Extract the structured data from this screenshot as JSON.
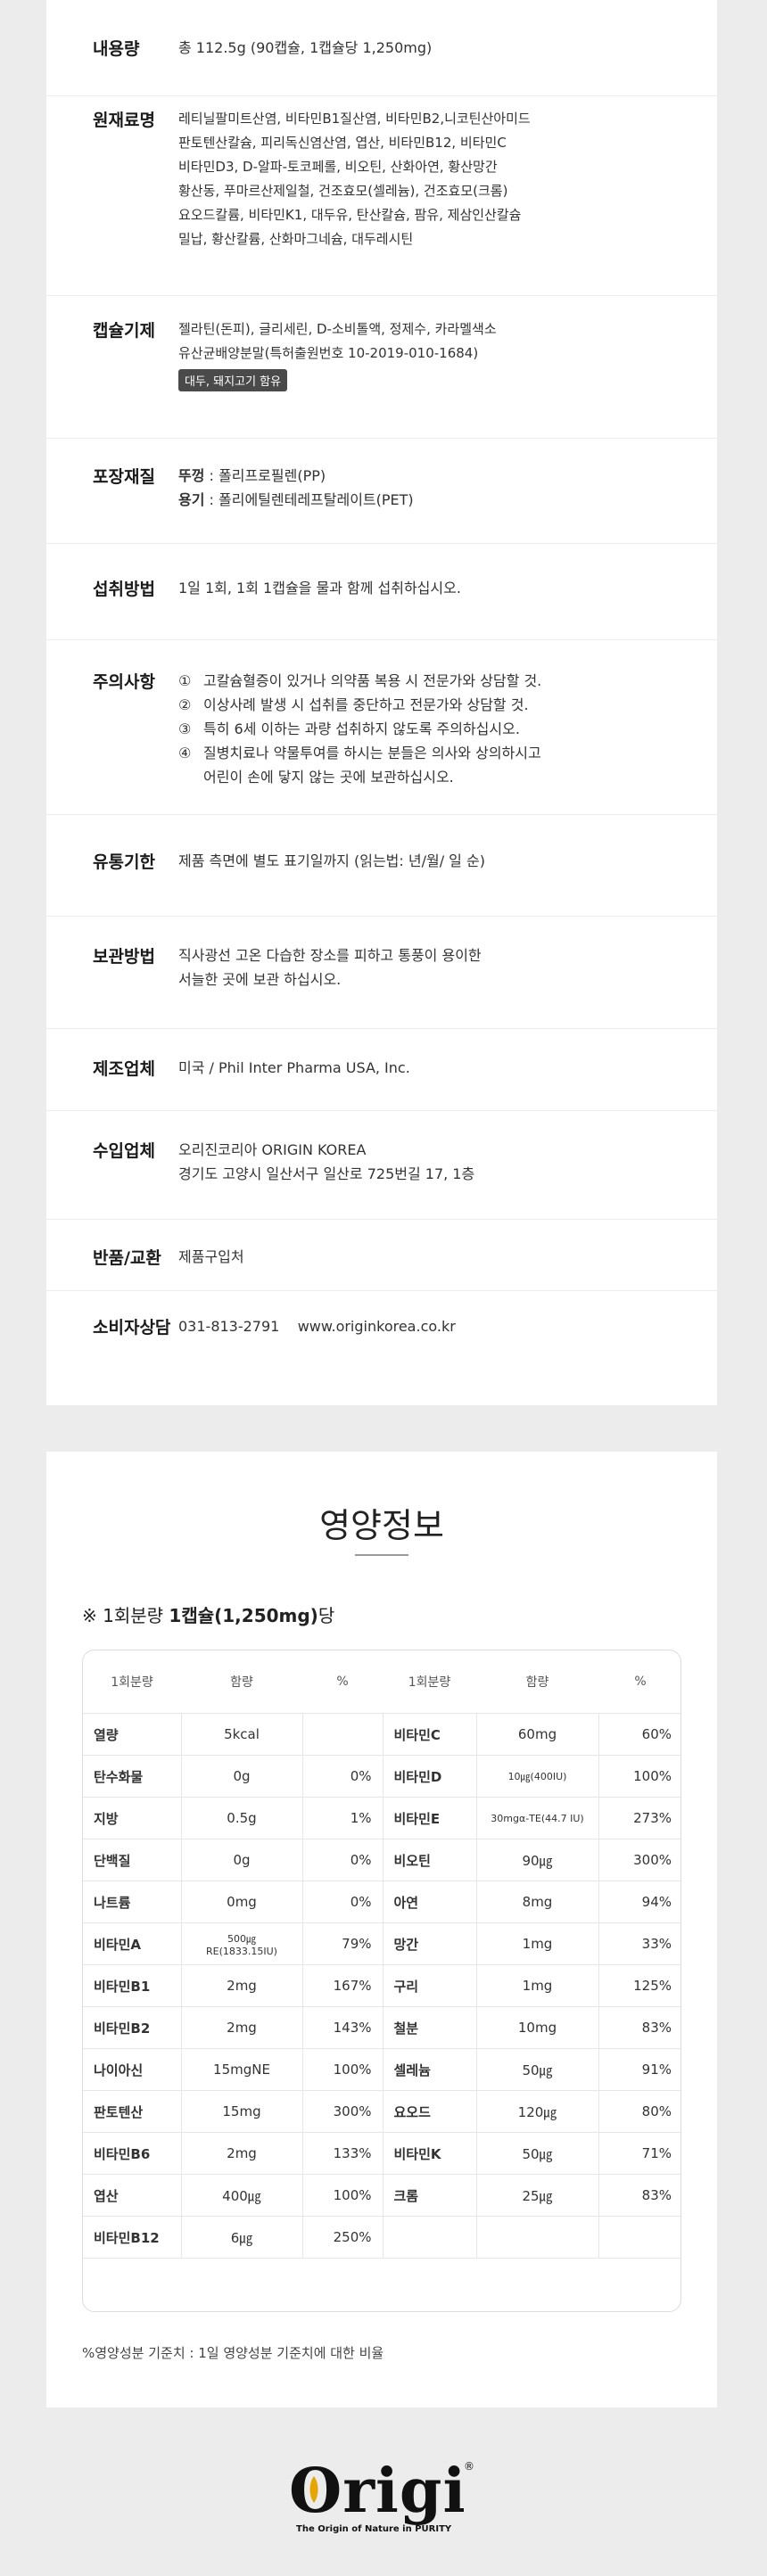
{
  "product_info": {
    "content": {
      "label": "내용량",
      "lines": [
        "총 112.5g (90캡슐, 1캡슐당 1,250mg)"
      ]
    },
    "ingredients": {
      "label": "원재료명",
      "lines": [
        "레티닐팔미트산염, 비타민B1질산염, 비타민B2,니코틴산아미드",
        "판토텐산칼슘, 피리독신염산염, 엽산, 비타민B12, 비타민C",
        "비타민D3, D-알파-토코페롤, 비오틴, 산화아연, 황산망간",
        "황산동, 푸마르산제일철, 건조효모(셀레늄), 건조효모(크롬)",
        "요오드칼륨, 비타민K1, 대두유, 탄산칼슘, 팜유, 제삼인산칼슘",
        "밀납, 황산칼륨, 산화마그네슘, 대두레시틴"
      ]
    },
    "capsule": {
      "label": "캡슐기제",
      "lines": [
        "젤라틴(돈피), 글리세린, D-소비톨액, 정제수, 카라멜색소",
        "유산균배양분말(특허출원번호 10-2019-010-1684)"
      ],
      "tag": "대두, 돼지고기 함유"
    },
    "packaging": {
      "label": "포장재질",
      "lid_label": "뚜껑",
      "lid_value": " : 폴리프로필렌(PP)",
      "container_label": "용기",
      "container_value": " : 폴리에틸렌테레프탈레이트(PET)"
    },
    "intake": {
      "label": "섭취방법",
      "lines": [
        "1일 1회, 1회 1캡슐을 물과 함께 섭취하십시오."
      ]
    },
    "caution": {
      "label": "주의사항",
      "items": [
        {
          "num": "①",
          "text": "고칼슘혈증이 있거나 의약품 복용 시 전문가와 상담할 것."
        },
        {
          "num": "②",
          "text": "이상사례 발생 시 섭취를 중단하고 전문가와 상담할 것."
        },
        {
          "num": "③",
          "text": "특히 6세 이하는 과량 섭취하지 않도록 주의하십시오."
        },
        {
          "num": "④",
          "text": "질병치료나 약물투여를 하시는 분들은 의사와 상의하시고"
        }
      ],
      "extra": "어린이 손에 닿지 않는 곳에 보관하십시오."
    },
    "expiry": {
      "label": "유통기한",
      "lines": [
        "제품 측면에 별도 표기일까지 (읽는법: 년/월/ 일 순)"
      ]
    },
    "storage": {
      "label": "보관방법",
      "lines": [
        "직사광선 고온 다습한 장소를 피하고 통풍이 용이한",
        "서늘한 곳에 보관 하십시오."
      ]
    },
    "manufacturer": {
      "label": "제조업체",
      "lines": [
        "미국 / Phil Inter Pharma USA, Inc."
      ]
    },
    "importer": {
      "label": "수입업체",
      "lines": [
        "오리진코리아 ORIGIN KOREA",
        "경기도 고양시 일산서구 일산로 725번길 17, 1층"
      ]
    },
    "returns": {
      "label": "반품/교환",
      "lines": [
        "제품구입처"
      ]
    },
    "consult": {
      "label": "소비자상담",
      "phone": "031-813-2791",
      "site": "www.originkorea.co.kr"
    }
  },
  "nutrition": {
    "title": "영양정보",
    "serving_prefix": "※ 1회분량 ",
    "serving_bold": "1캡슐(1,250mg)",
    "serving_suffix": "당",
    "headers": [
      "1회분량",
      "함량",
      "%",
      "1회분량",
      "함량",
      "%"
    ],
    "left": [
      {
        "name": "열량",
        "amount": "5kcal",
        "pct": ""
      },
      {
        "name": "탄수화물",
        "amount": "0g",
        "pct": "0%"
      },
      {
        "name": "지방",
        "amount": "0.5g",
        "pct": "1%"
      },
      {
        "name": "단백질",
        "amount": "0g",
        "pct": "0%"
      },
      {
        "name": "나트륨",
        "amount": "0mg",
        "pct": "0%"
      },
      {
        "name": "비타민A",
        "amount": "500㎍RE(1833.15IU)",
        "pct": "79%",
        "small": true
      },
      {
        "name": "비타민B1",
        "amount": "2mg",
        "pct": "167%"
      },
      {
        "name": "비타민B2",
        "amount": "2mg",
        "pct": "143%"
      },
      {
        "name": "나이아신",
        "amount": "15mgNE",
        "pct": "100%"
      },
      {
        "name": "판토텐산",
        "amount": "15mg",
        "pct": "300%"
      },
      {
        "name": "비타민B6",
        "amount": "2mg",
        "pct": "133%"
      },
      {
        "name": "엽산",
        "amount": "400㎍",
        "pct": "100%"
      },
      {
        "name": "비타민B12",
        "amount": "6㎍",
        "pct": "250%"
      }
    ],
    "right": [
      {
        "name": "비타민C",
        "amount": "60mg",
        "pct": "60%"
      },
      {
        "name": "비타민D",
        "amount": "10㎍(400IU)",
        "pct": "100%",
        "small": true
      },
      {
        "name": "비타민E",
        "amount": "30mgα-TE(44.7 IU)",
        "pct": "273%",
        "small": true
      },
      {
        "name": "비오틴",
        "amount": "90㎍",
        "pct": "300%"
      },
      {
        "name": "아연",
        "amount": "8mg",
        "pct": "94%"
      },
      {
        "name": "망간",
        "amount": "1mg",
        "pct": "33%"
      },
      {
        "name": "구리",
        "amount": "1mg",
        "pct": "125%"
      },
      {
        "name": "철분",
        "amount": "10mg",
        "pct": "83%"
      },
      {
        "name": "셀레늄",
        "amount": "50㎍",
        "pct": "91%"
      },
      {
        "name": "요오드",
        "amount": "120㎍",
        "pct": "80%"
      },
      {
        "name": "비타민K",
        "amount": "50㎍",
        "pct": "71%"
      },
      {
        "name": "크롬",
        "amount": "25㎍",
        "pct": "83%"
      },
      {
        "name": "",
        "amount": "",
        "pct": ""
      }
    ],
    "note": "%영양성분 기준치 : 1일 영양성분 기준치에 대한 비율"
  },
  "logo": {
    "word": "Origin",
    "reg": "®",
    "tagline": "The Origin of Nature in PURITY"
  },
  "colors": {
    "background": "#ececec",
    "card": "#ffffff",
    "tag_bg": "#4a4a4a",
    "text": "#222222"
  }
}
